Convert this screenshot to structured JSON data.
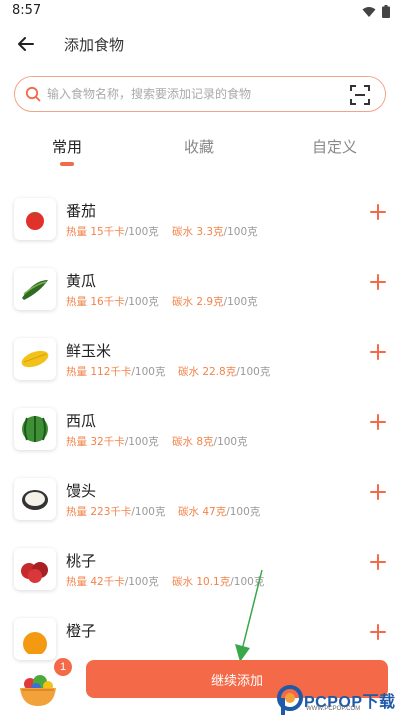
{
  "status_bar": {
    "time": "8:57"
  },
  "header": {
    "title": "添加食物"
  },
  "search": {
    "placeholder": "输入食物名称，搜索要添加记录的食物"
  },
  "tabs": [
    {
      "label": "常用",
      "active": true
    },
    {
      "label": "收藏",
      "active": false
    },
    {
      "label": "自定义",
      "active": false
    }
  ],
  "foods": [
    {
      "name": "番茄",
      "calorie_label": "热量",
      "calorie": "15千卡",
      "calorie_unit": "/100克",
      "carb_label": "碳水",
      "carb": "3.3克",
      "carb_unit": "/100克",
      "icon": "tomato-icon"
    },
    {
      "name": "黄瓜",
      "calorie_label": "热量",
      "calorie": "16千卡",
      "calorie_unit": "/100克",
      "carb_label": "碳水",
      "carb": "2.9克",
      "carb_unit": "/100克",
      "icon": "cucumber-icon"
    },
    {
      "name": "鲜玉米",
      "calorie_label": "热量",
      "calorie": "112千卡",
      "calorie_unit": "/100克",
      "carb_label": "碳水",
      "carb": "22.8克",
      "carb_unit": "/100克",
      "icon": "corn-icon"
    },
    {
      "name": "西瓜",
      "calorie_label": "热量",
      "calorie": "32千卡",
      "calorie_unit": "/100克",
      "carb_label": "碳水",
      "carb": "8克",
      "carb_unit": "/100克",
      "icon": "watermelon-icon"
    },
    {
      "name": "馒头",
      "calorie_label": "热量",
      "calorie": "223千卡",
      "calorie_unit": "/100克",
      "carb_label": "碳水",
      "carb": "47克",
      "carb_unit": "/100克",
      "icon": "steamed-bun-icon"
    },
    {
      "name": "桃子",
      "calorie_label": "热量",
      "calorie": "42千卡",
      "calorie_unit": "/100克",
      "carb_label": "碳水",
      "carb": "10.1克",
      "carb_unit": "/100克",
      "icon": "peach-icon"
    },
    {
      "name": "橙子",
      "icon": "orange-icon"
    }
  ],
  "cart": {
    "badge": "1",
    "icon": "salad-bowl-icon"
  },
  "continue_button": {
    "label": "继续添加"
  },
  "watermark": {
    "brand": "PCPOP下载",
    "subtitle": "WWW.PCPOP.COM"
  },
  "colors": {
    "accent": "#f46a48",
    "highlight": "#f2834a",
    "search_border": "#f2a48a",
    "arrow": "#3aa84a"
  }
}
